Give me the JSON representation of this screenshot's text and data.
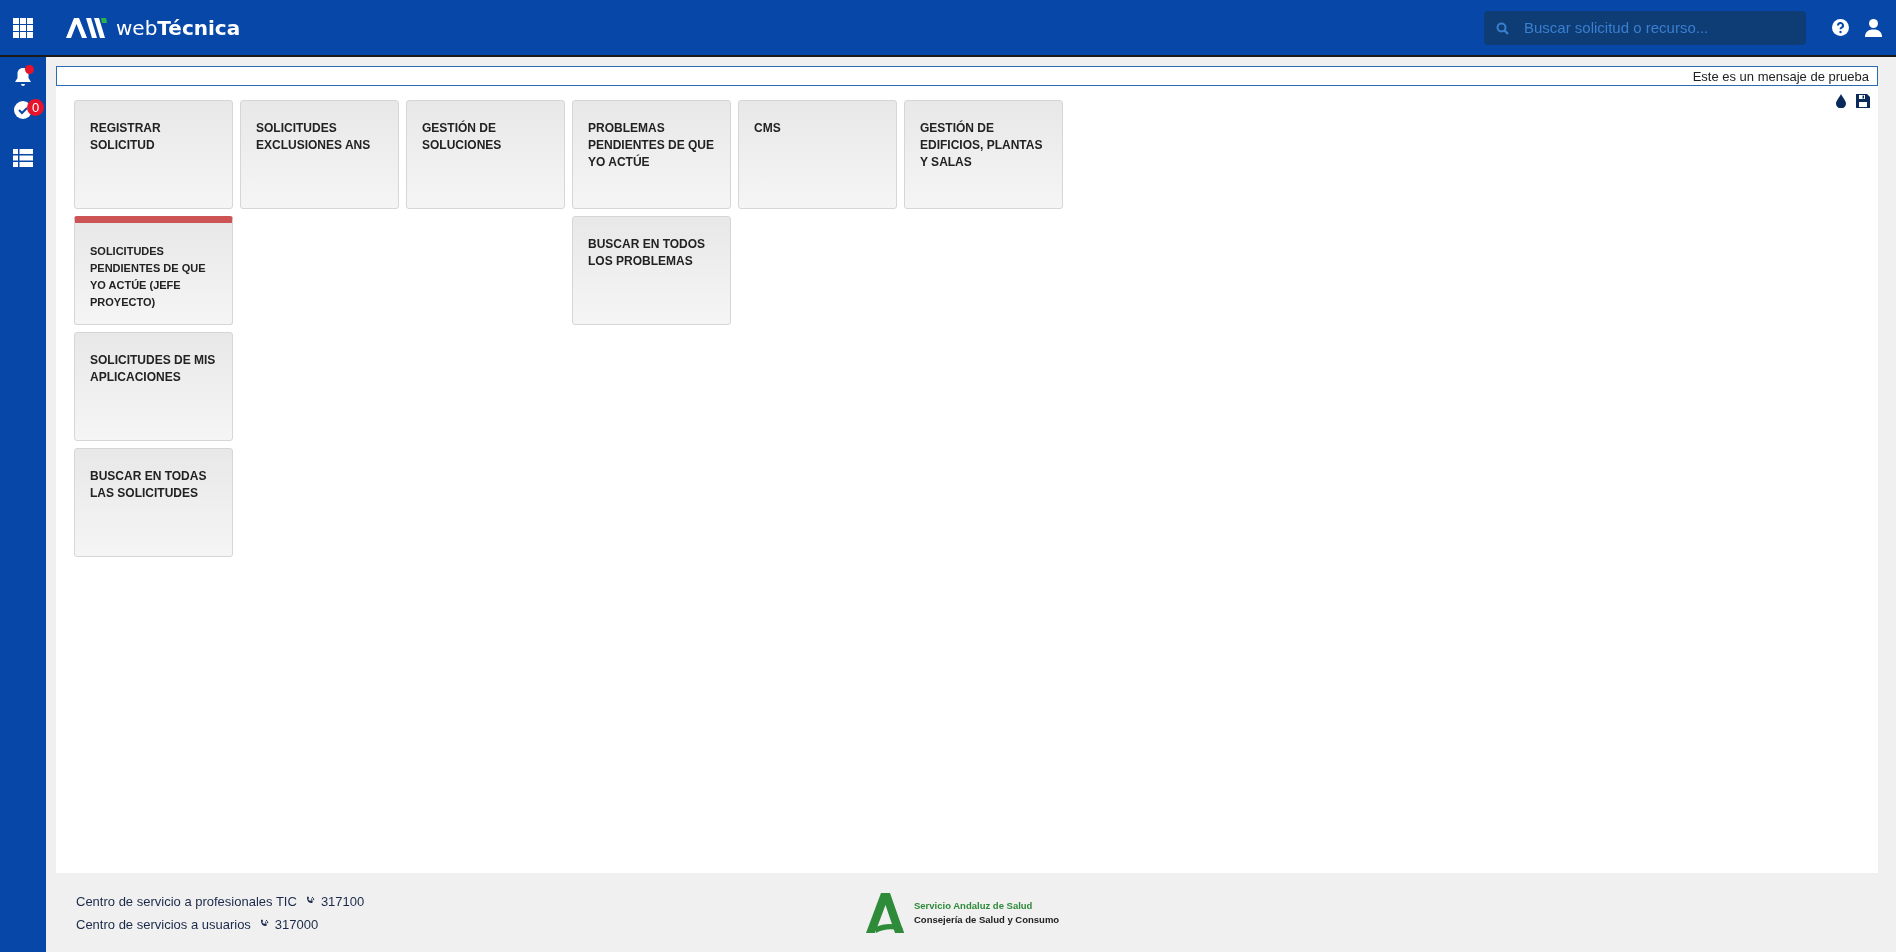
{
  "header": {
    "logo_text": "web",
    "logo_text_bold": "Técnica",
    "search": {
      "placeholder": "Buscar solicitud o recurso..."
    }
  },
  "sidebar": {
    "notifications_dot": true,
    "tasks_badge": "0"
  },
  "message": "Este es un mensaje de prueba",
  "tile_columns": [
    {
      "tiles": [
        {
          "label": "REGISTRAR SOLICITUD",
          "flagged": false
        },
        {
          "label": "SOLICITUDES PENDIENTES DE QUE YO ACTÚE (JEFE PROYECTO)",
          "flagged": true
        },
        {
          "label": "SOLICITUDES DE MIS APLICACIONES",
          "flagged": false
        },
        {
          "label": "BUSCAR EN TODAS LAS SOLICITUDES",
          "flagged": false
        }
      ]
    },
    {
      "tiles": [
        {
          "label": "SOLICITUDES EXCLUSIONES ANS",
          "flagged": false
        }
      ]
    },
    {
      "tiles": [
        {
          "label": "GESTIÓN DE SOLUCIONES",
          "flagged": false
        }
      ]
    },
    {
      "tiles": [
        {
          "label": "PROBLEMAS PENDIENTES DE QUE YO ACTÚE",
          "flagged": false
        },
        {
          "label": "BUSCAR EN TODOS LOS PROBLEMAS",
          "flagged": false
        }
      ]
    },
    {
      "tiles": [
        {
          "label": "CMS",
          "flagged": false
        }
      ]
    },
    {
      "tiles": [
        {
          "label": "GESTIÓN DE EDIFICIOS, PLANTAS Y SALAS",
          "flagged": false
        }
      ]
    }
  ],
  "footer": {
    "contacts": [
      {
        "label": "Centro de servicio a profesionales TIC",
        "phone": "317100"
      },
      {
        "label": "Centro de servicios a usuarios",
        "phone": "317000"
      }
    ],
    "org_name": "Servicio Andaluz de Salud",
    "org_dept": "Consejería de Salud y Consumo"
  }
}
